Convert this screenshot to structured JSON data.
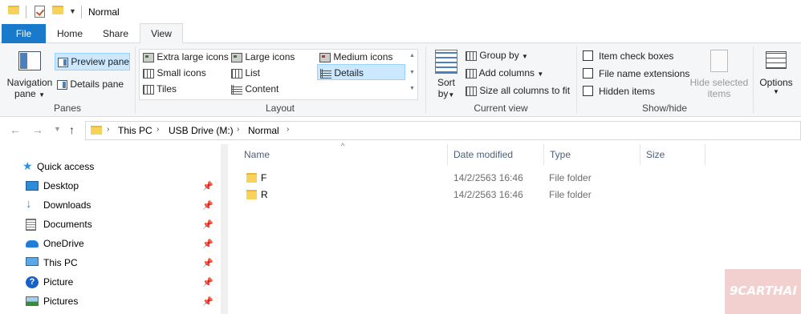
{
  "window": {
    "title": "Normal"
  },
  "tabs": [
    {
      "label": "File"
    },
    {
      "label": "Home"
    },
    {
      "label": "Share"
    },
    {
      "label": "View"
    }
  ],
  "ribbon": {
    "panes": {
      "label": "Panes",
      "navigation_pane": "Navigation",
      "navigation_pane_2": "pane",
      "preview_pane": "Preview pane",
      "details_pane": "Details pane"
    },
    "layout": {
      "label": "Layout",
      "options": [
        "Extra large icons",
        "Large icons",
        "Medium icons",
        "Small icons",
        "List",
        "Details",
        "Tiles",
        "Content"
      ],
      "selected": "Details"
    },
    "current_view": {
      "label": "Current view",
      "sort_by_1": "Sort",
      "sort_by_2": "by",
      "group_by": "Group by",
      "add_columns": "Add columns",
      "size_all": "Size all columns to fit"
    },
    "show_hide": {
      "label": "Show/hide",
      "item_check_boxes": "Item check boxes",
      "file_name_extensions": "File name extensions",
      "hidden_items": "Hidden items",
      "hide_selected_1": "Hide selected",
      "hide_selected_2": "items"
    },
    "options": {
      "label": "Options"
    }
  },
  "address": {
    "crumbs": [
      "This PC",
      "USB Drive (M:)",
      "Normal"
    ]
  },
  "sidebar": {
    "items": [
      {
        "label": "Quick access",
        "icon": "star-icon"
      },
      {
        "label": "Desktop",
        "icon": "desktop-icon"
      },
      {
        "label": "Downloads",
        "icon": "download-icon"
      },
      {
        "label": "Documents",
        "icon": "documents-icon"
      },
      {
        "label": "OneDrive",
        "icon": "cloud-icon"
      },
      {
        "label": "This PC",
        "icon": "computer-icon"
      },
      {
        "label": "Picture",
        "icon": "help-icon"
      },
      {
        "label": "Pictures",
        "icon": "pictures-icon"
      }
    ]
  },
  "filelist": {
    "columns": [
      "Name",
      "Date modified",
      "Type",
      "Size"
    ],
    "rows": [
      {
        "name": "F",
        "date": "14/2/2563 16:46",
        "type": "File folder"
      },
      {
        "name": "R",
        "date": "14/2/2563 16:46",
        "type": "File folder"
      }
    ]
  },
  "watermark": "9CARTHAI"
}
